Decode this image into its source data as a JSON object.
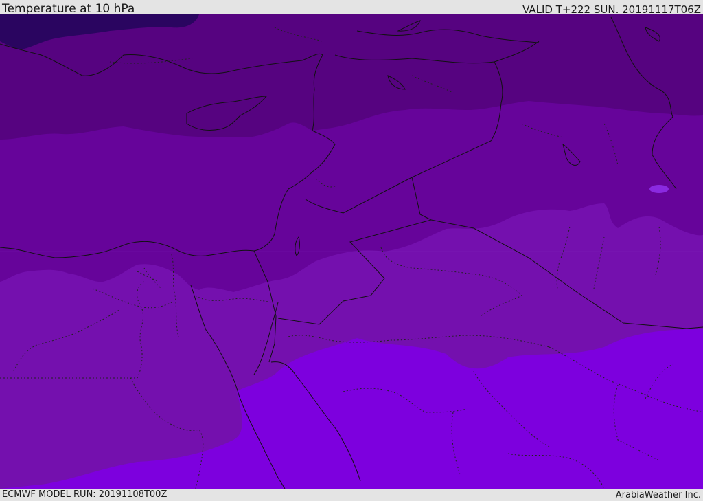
{
  "header": {
    "title": "Temperature at 10 hPa",
    "valid": "VALID T+222 SUN. 20191117T06Z"
  },
  "footer": {
    "model_run": "ECMWF MODEL RUN: 20191108T00Z",
    "credit": "ArabiaWeather Inc."
  },
  "map": {
    "region": "Eastern Mediterranean and Middle East",
    "field": "temperature",
    "level": "10 hPa",
    "colors": {
      "darkest": "#2a0560",
      "band1": "#560380",
      "band2": "#66049a",
      "band3": "#7410ae",
      "band4": "#7d00de",
      "coast": "#111111",
      "border": "#111111",
      "province": "#222222"
    }
  }
}
